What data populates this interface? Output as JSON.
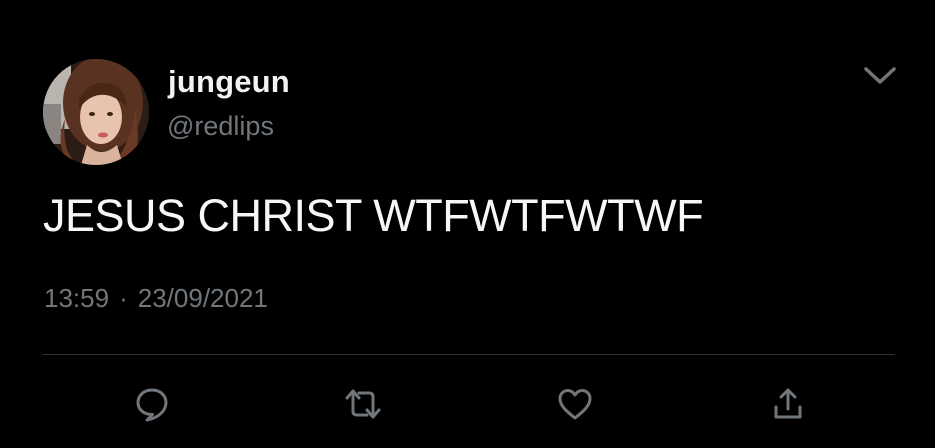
{
  "tweet": {
    "author": {
      "display_name": "jungeun",
      "handle": "@redlips",
      "avatar_icon": "profile-photo"
    },
    "text": "JESUS CHRIST WTFWTFWTWF",
    "time": "13:59",
    "separator": "·",
    "date": "23/09/2021"
  },
  "actions": [
    {
      "name": "reply",
      "icon": "speech-bubble-icon"
    },
    {
      "name": "retweet",
      "icon": "retweet-arrows-icon"
    },
    {
      "name": "like",
      "icon": "heart-icon"
    },
    {
      "name": "share",
      "icon": "share-upload-icon"
    }
  ],
  "menu": {
    "icon": "chevron-down-icon"
  },
  "colors": {
    "background": "#000000",
    "primary_text": "#f7f7f7",
    "secondary_text": "#71767b",
    "divider": "#2f3336",
    "icon": "#71767b"
  }
}
